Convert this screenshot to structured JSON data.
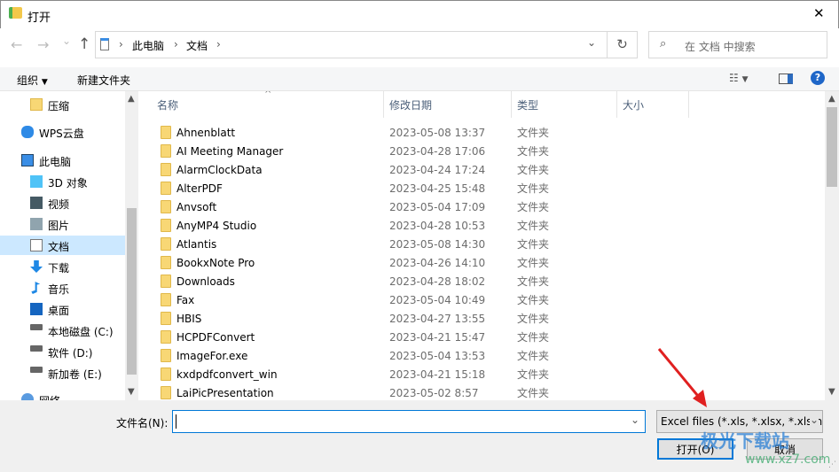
{
  "window": {
    "title": "打开",
    "close": "✕"
  },
  "nav": {
    "back": "←",
    "forward": "→",
    "recent": "⌄",
    "up": "↑",
    "breadcrumb": [
      "此电脑",
      "文档"
    ],
    "refresh": "↻",
    "search_placeholder": "在 文档 中搜索"
  },
  "toolbar": {
    "organize": "组织",
    "new_folder": "新建文件夹"
  },
  "sidebar": {
    "items": [
      {
        "label": "压缩",
        "icon": "folder-icon"
      },
      {
        "label": "WPS云盘",
        "icon": "cloud-icon"
      },
      {
        "label": "此电脑",
        "icon": "computer-icon"
      },
      {
        "label": "3D 对象",
        "icon": "cube-icon"
      },
      {
        "label": "视频",
        "icon": "video-icon"
      },
      {
        "label": "图片",
        "icon": "picture-icon"
      },
      {
        "label": "文档",
        "icon": "document-icon",
        "selected": true
      },
      {
        "label": "下载",
        "icon": "download-icon"
      },
      {
        "label": "音乐",
        "icon": "music-icon"
      },
      {
        "label": "桌面",
        "icon": "desktop-icon"
      },
      {
        "label": "本地磁盘 (C:)",
        "icon": "drive-icon"
      },
      {
        "label": "软件 (D:)",
        "icon": "drive-icon"
      },
      {
        "label": "新加卷 (E:)",
        "icon": "drive-icon"
      },
      {
        "label": "网络",
        "icon": "network-icon"
      }
    ]
  },
  "columns": [
    "名称",
    "修改日期",
    "类型",
    "大小"
  ],
  "files": [
    {
      "name": "Ahnenblatt",
      "date": "2023-05-08 13:37",
      "type": "文件夹"
    },
    {
      "name": "AI Meeting Manager",
      "date": "2023-04-28 17:06",
      "type": "文件夹"
    },
    {
      "name": "AlarmClockData",
      "date": "2023-04-24 17:24",
      "type": "文件夹"
    },
    {
      "name": "AlterPDF",
      "date": "2023-04-25 15:48",
      "type": "文件夹"
    },
    {
      "name": "Anvsoft",
      "date": "2023-05-04 17:09",
      "type": "文件夹"
    },
    {
      "name": "AnyMP4 Studio",
      "date": "2023-04-28 10:53",
      "type": "文件夹"
    },
    {
      "name": "Atlantis",
      "date": "2023-05-08 14:30",
      "type": "文件夹"
    },
    {
      "name": "BookxNote Pro",
      "date": "2023-04-26 14:10",
      "type": "文件夹"
    },
    {
      "name": "Downloads",
      "date": "2023-04-28 18:02",
      "type": "文件夹"
    },
    {
      "name": "Fax",
      "date": "2023-05-04 10:49",
      "type": "文件夹"
    },
    {
      "name": "HBIS",
      "date": "2023-04-27 13:55",
      "type": "文件夹"
    },
    {
      "name": "HCPDFConvert",
      "date": "2023-04-21 15:47",
      "type": "文件夹"
    },
    {
      "name": "ImageFor.exe",
      "date": "2023-05-04 13:53",
      "type": "文件夹"
    },
    {
      "name": "kxdpdfconvert_win",
      "date": "2023-04-21 15:18",
      "type": "文件夹"
    },
    {
      "name": "LaiPicPresentation",
      "date": "2023-05-02 8:57",
      "type": "文件夹"
    }
  ],
  "footer": {
    "filename_label": "文件名(N):",
    "filename_value": "",
    "filter": "Excel files (*.xls, *.xlsx, *.xlsm",
    "open": "打开(O)",
    "cancel": "取消"
  },
  "watermark": {
    "text": "极光下载站",
    "url": "www.xz7.com"
  },
  "colors": {
    "accent": "#0078d7",
    "selected": "#cce8ff",
    "arrow": "#e02020"
  }
}
